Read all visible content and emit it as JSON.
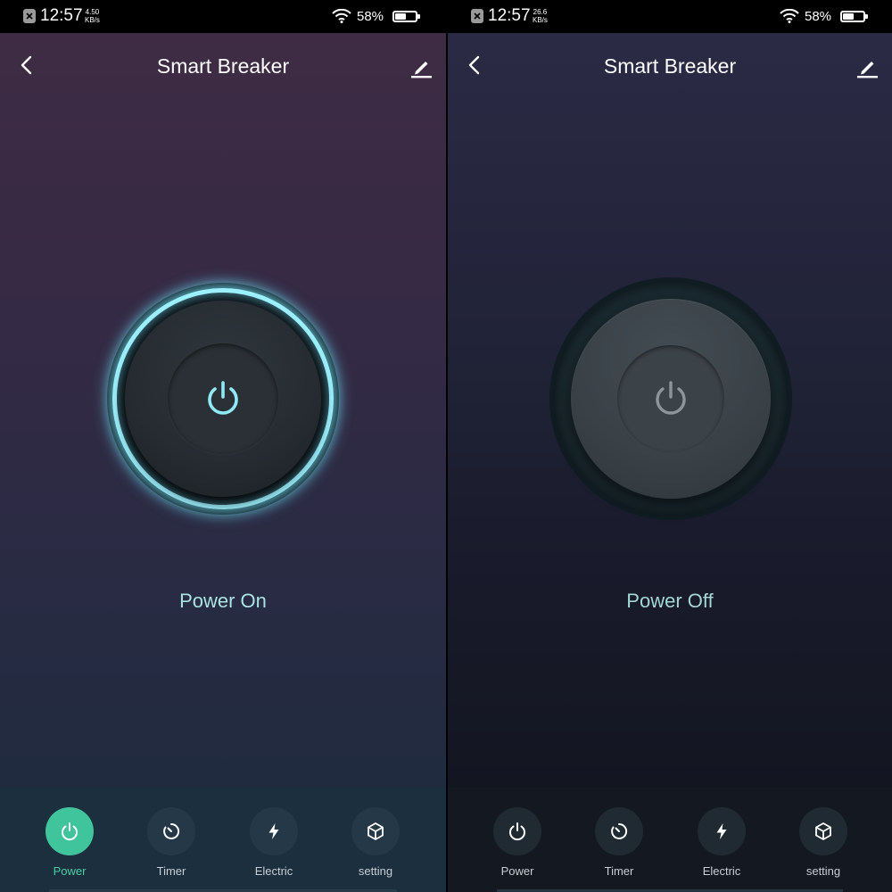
{
  "screens": [
    {
      "statusbar": {
        "time": "12:57",
        "speed_value": "4.50",
        "speed_unit": "KB/s",
        "battery": "58%"
      },
      "header": {
        "title": "Smart Breaker"
      },
      "power": {
        "state_label": "Power On",
        "is_on": true
      },
      "tabs": [
        {
          "label": "Power",
          "icon": "power-icon",
          "active": true
        },
        {
          "label": "Timer",
          "icon": "timer-icon",
          "active": false
        },
        {
          "label": "Electric",
          "icon": "lightning-icon",
          "active": false
        },
        {
          "label": "setting",
          "icon": "cube-icon",
          "active": false
        }
      ]
    },
    {
      "statusbar": {
        "time": "12:57",
        "speed_value": "26.6",
        "speed_unit": "KB/s",
        "battery": "58%"
      },
      "header": {
        "title": "Smart Breaker"
      },
      "power": {
        "state_label": "Power Off",
        "is_on": false
      },
      "tabs": [
        {
          "label": "Power",
          "icon": "power-icon",
          "active": false
        },
        {
          "label": "Timer",
          "icon": "timer-icon",
          "active": false
        },
        {
          "label": "Electric",
          "icon": "lightning-icon",
          "active": false
        },
        {
          "label": "setting",
          "icon": "cube-icon",
          "active": false
        }
      ]
    }
  ],
  "colors": {
    "accent": "#40c49c",
    "glow": "#9df2ff",
    "label": "#a9e4e2"
  }
}
